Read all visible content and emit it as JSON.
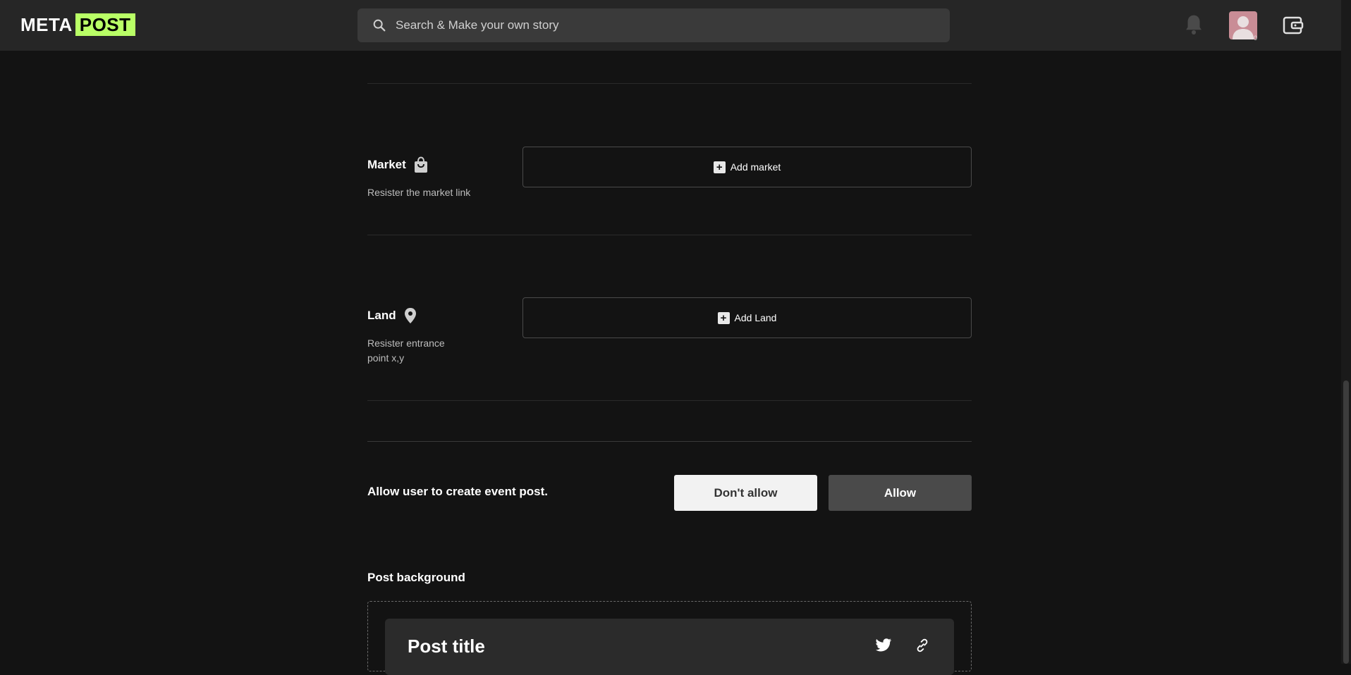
{
  "header": {
    "logo_left": "META",
    "logo_right": "POST",
    "search_placeholder": "Search & Make your own story",
    "avatar_count": "0",
    "icons": [
      "search-icon",
      "bell-icon",
      "avatar",
      "wallet-icon"
    ]
  },
  "market": {
    "title": "Market",
    "icon": "shopping-bag-icon",
    "description": "Resister the market link",
    "button_label": "Add market"
  },
  "land": {
    "title": "Land",
    "icon": "map-pin-icon",
    "description_line1": "Resister entrance",
    "description_line2": "point x,y",
    "button_label": "Add Land"
  },
  "event_permission": {
    "label": "Allow user to create event post.",
    "dont_allow_label": "Don't allow",
    "allow_label": "Allow"
  },
  "post_background": {
    "label": "Post background",
    "card_title": "Post title",
    "icons": [
      "twitter-icon",
      "link-icon"
    ]
  },
  "colors": {
    "background": "#131313",
    "header": "#262626",
    "brand_green": "#b9ff66",
    "button_light": "#f2f2f2",
    "button_dark": "#4a4a4a"
  }
}
